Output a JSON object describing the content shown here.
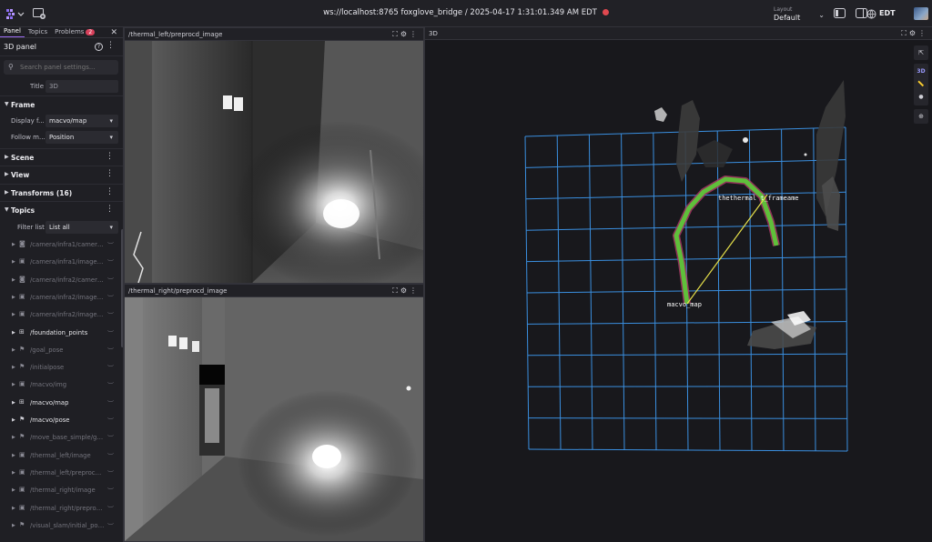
{
  "topbar": {
    "connection": "ws://localhost:8765 foxglove_bridge / 2025-04-17 1:31:01.349 AM EDT",
    "layout_caption": "Layout",
    "layout_value": "Default",
    "timezone": "EDT"
  },
  "left_panel": {
    "tabs": [
      {
        "label": "Panel"
      },
      {
        "label": "Topics"
      },
      {
        "label": "Problems",
        "badge": "2"
      }
    ],
    "header_title": "3D panel",
    "search_placeholder": "Search panel settings...",
    "title_label": "Title",
    "title_value": "3D",
    "frame_section": "Frame",
    "display_frame_label": "Display f...",
    "display_frame_value": "macvo/map",
    "follow_mode_label": "Follow m...",
    "follow_mode_value": "Position",
    "scene_section": "Scene",
    "view_section": "View",
    "transforms_section": "Transforms (16)",
    "topics_section": "Topics",
    "filter_label": "Filter list",
    "filter_value": "List all",
    "topics": [
      {
        "name": "/camera/infra1/camera_i...",
        "icon": "camera-icon",
        "on": false
      },
      {
        "name": "/camera/infra1/image_re...",
        "icon": "image-icon",
        "on": false
      },
      {
        "name": "/camera/infra2/camera_i...",
        "icon": "camera-icon",
        "on": false
      },
      {
        "name": "/camera/infra2/image_re...",
        "icon": "image-icon",
        "on": false
      },
      {
        "name": "/camera/infra2/image_re...",
        "icon": "image-icon",
        "on": false
      },
      {
        "name": "/foundation_points",
        "icon": "grid-icon",
        "on": true
      },
      {
        "name": "/goal_pose",
        "icon": "flag-icon",
        "on": false
      },
      {
        "name": "/initialpose",
        "icon": "flag-icon",
        "on": false
      },
      {
        "name": "/macvo/img",
        "icon": "image-icon",
        "on": false
      },
      {
        "name": "/macvo/map",
        "icon": "grid-icon",
        "on": true
      },
      {
        "name": "/macvo/pose",
        "icon": "flag-icon",
        "on": true
      },
      {
        "name": "/move_base_simple/goal",
        "icon": "flag-icon",
        "on": false
      },
      {
        "name": "/thermal_left/image",
        "icon": "image-icon",
        "on": false
      },
      {
        "name": "/thermal_left/preprocd_i...",
        "icon": "image-icon",
        "on": false
      },
      {
        "name": "/thermal_right/image",
        "icon": "image-icon",
        "on": false
      },
      {
        "name": "/thermal_right/preprocd...",
        "icon": "image-icon",
        "on": false
      },
      {
        "name": "/visual_slam/initial_pose",
        "icon": "flag-icon",
        "on": false
      }
    ]
  },
  "panels": {
    "thermal_left_title": "/thermal_left/preprocd_image",
    "thermal_right_title": "/thermal_right/preprocd_image",
    "three_d_title": "3D"
  },
  "scene": {
    "label_map": "macvo_map",
    "label_frame": "thethermal t_frameame",
    "grid_color": "#3a8fe0",
    "path_color": "#5fbf3a",
    "link_color": "#e6e04a"
  },
  "colors": {
    "accent": "#9b6bf2",
    "error": "#e0484f",
    "badge": "#d8405b"
  }
}
